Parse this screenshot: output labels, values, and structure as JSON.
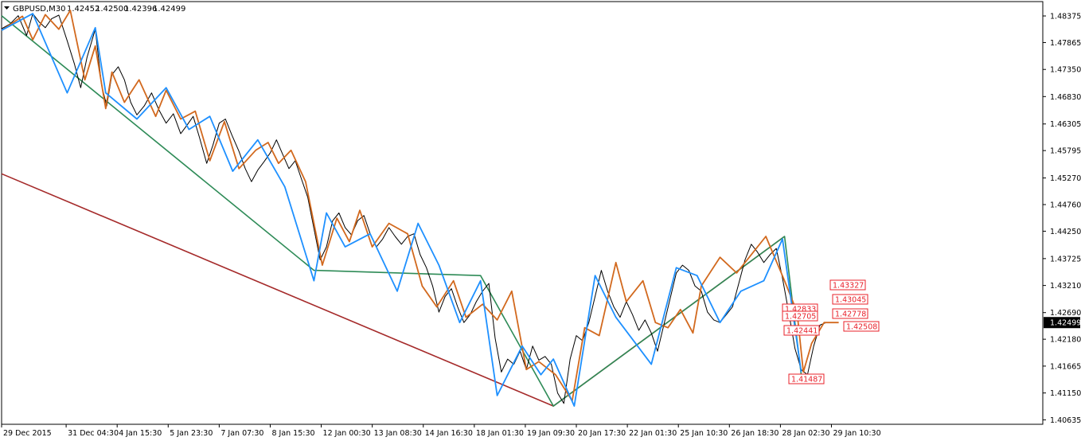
{
  "header": {
    "symbol": "GBPUSD,M30",
    "open": "1.42452",
    "high": "1.42500",
    "low": "1.42396",
    "close": "1.42499"
  },
  "colors": {
    "price": "#000000",
    "zigzag_fast": "#d2691e",
    "zigzag_mid": "#1e90ff",
    "zigzag_slow": "#2e8b57",
    "zigzag_major": "#a52a2a",
    "level_box": "#e8202a",
    "current_price_bg": "#000000",
    "axis": "#000000"
  },
  "chart_data": {
    "type": "line",
    "chart_subtype": "candlestick price chart with zigzag overlays",
    "ylim": [
      1.4055,
      1.4865
    ],
    "y_ticks": [
      "1.48375",
      "1.47865",
      "1.47350",
      "1.46830",
      "1.46305",
      "1.45795",
      "1.45270",
      "1.44760",
      "1.44250",
      "1.43725",
      "1.43210",
      "1.42690",
      "1.42180",
      "1.41665",
      "1.41150",
      "1.40635"
    ],
    "x_ticks": [
      "29 Dec 2015",
      "31 Dec 04:30",
      "4 Jan 15:30",
      "5 Jan 23:30",
      "7 Jan 07:30",
      "8 Jan 15:30",
      "12 Jan 00:30",
      "13 Jan 08:30",
      "14 Jan 16:30",
      "18 Jan 01:30",
      "19 Jan 09:30",
      "20 Jan 17:30",
      "22 Jan 01:30",
      "25 Jan 10:30",
      "26 Jan 18:30",
      "28 Jan 02:30",
      "29 Jan 10:30"
    ],
    "x_tick_positions": [
      0,
      0.062,
      0.111,
      0.16,
      0.209,
      0.258,
      0.307,
      0.356,
      0.405,
      0.454,
      0.503,
      0.552,
      0.601,
      0.65,
      0.699,
      0.748,
      0.797
    ],
    "price_series": {
      "name": "GBPUSD,M30",
      "x": [
        0.0,
        0.008,
        0.016,
        0.024,
        0.03,
        0.036,
        0.042,
        0.048,
        0.055,
        0.063,
        0.07,
        0.076,
        0.082,
        0.09,
        0.096,
        0.101,
        0.106,
        0.112,
        0.118,
        0.124,
        0.13,
        0.137,
        0.144,
        0.151,
        0.158,
        0.165,
        0.172,
        0.178,
        0.184,
        0.19,
        0.197,
        0.203,
        0.209,
        0.215,
        0.221,
        0.228,
        0.234,
        0.24,
        0.246,
        0.252,
        0.258,
        0.264,
        0.27,
        0.276,
        0.282,
        0.288,
        0.294,
        0.3,
        0.306,
        0.312,
        0.318,
        0.324,
        0.33,
        0.336,
        0.342,
        0.348,
        0.354,
        0.36,
        0.366,
        0.372,
        0.378,
        0.384,
        0.39,
        0.396,
        0.402,
        0.408,
        0.414,
        0.42,
        0.426,
        0.432,
        0.438,
        0.444,
        0.45,
        0.456,
        0.462,
        0.468,
        0.474,
        0.48,
        0.486,
        0.492,
        0.498,
        0.504,
        0.51,
        0.516,
        0.522,
        0.528,
        0.534,
        0.54,
        0.546,
        0.552,
        0.558,
        0.564,
        0.57,
        0.576,
        0.582,
        0.588,
        0.594,
        0.6,
        0.606,
        0.612,
        0.618,
        0.624,
        0.63,
        0.636,
        0.642,
        0.648,
        0.654,
        0.66,
        0.666,
        0.672,
        0.678,
        0.684,
        0.69,
        0.696,
        0.702,
        0.708,
        0.714,
        0.72,
        0.726,
        0.732,
        0.738,
        0.744,
        0.75,
        0.756,
        0.762,
        0.768,
        0.774,
        0.78,
        0.786,
        0.792,
        0.798,
        0.804
      ],
      "values": [
        1.4813,
        1.4822,
        1.4838,
        1.48,
        1.4842,
        1.4826,
        1.4815,
        1.4832,
        1.4839,
        1.479,
        1.4745,
        1.47,
        1.4758,
        1.4812,
        1.4705,
        1.4665,
        1.4725,
        1.474,
        1.4715,
        1.4672,
        1.4648,
        1.4665,
        1.469,
        1.4658,
        1.4632,
        1.465,
        1.4612,
        1.4628,
        1.4645,
        1.4605,
        1.4555,
        1.459,
        1.4632,
        1.464,
        1.461,
        1.4578,
        1.4545,
        1.452,
        1.4542,
        1.4558,
        1.4575,
        1.46,
        1.4572,
        1.4545,
        1.456,
        1.4525,
        1.449,
        1.443,
        1.437,
        1.4395,
        1.4445,
        1.446,
        1.4432,
        1.4418,
        1.4445,
        1.4455,
        1.442,
        1.4395,
        1.441,
        1.4432,
        1.4415,
        1.44,
        1.4415,
        1.442,
        1.438,
        1.4355,
        1.432,
        1.427,
        1.43,
        1.4315,
        1.428,
        1.425,
        1.4265,
        1.429,
        1.431,
        1.4325,
        1.422,
        1.4155,
        1.418,
        1.417,
        1.4195,
        1.416,
        1.4205,
        1.4178,
        1.4185,
        1.417,
        1.4115,
        1.4095,
        1.418,
        1.4225,
        1.4215,
        1.425,
        1.43,
        1.435,
        1.431,
        1.428,
        1.426,
        1.429,
        1.4265,
        1.4235,
        1.4255,
        1.423,
        1.4195,
        1.4245,
        1.4295,
        1.4345,
        1.436,
        1.435,
        1.432,
        1.431,
        1.427,
        1.4255,
        1.425,
        1.4265,
        1.428,
        1.4325,
        1.437,
        1.44,
        1.4385,
        1.4365,
        1.438,
        1.4392,
        1.4335,
        1.427,
        1.42,
        1.416,
        1.415,
        1.4205,
        1.4245,
        1.425
      ]
    },
    "zigzag_fast": {
      "x": [
        0.0,
        0.02,
        0.03,
        0.042,
        0.055,
        0.066,
        0.08,
        0.09,
        0.1,
        0.106,
        0.118,
        0.132,
        0.148,
        0.158,
        0.172,
        0.186,
        0.2,
        0.214,
        0.228,
        0.244,
        0.256,
        0.266,
        0.278,
        0.292,
        0.308,
        0.322,
        0.334,
        0.344,
        0.356,
        0.372,
        0.39,
        0.404,
        0.418,
        0.434,
        0.446,
        0.462,
        0.476,
        0.49,
        0.504,
        0.516,
        0.532,
        0.548,
        0.56,
        0.574,
        0.59,
        0.6,
        0.616,
        0.628,
        0.64,
        0.652,
        0.664,
        0.672,
        0.69,
        0.706,
        0.72,
        0.734,
        0.752,
        0.764,
        0.77,
        0.778,
        0.79,
        0.804
      ],
      "values": [
        1.481,
        1.4837,
        1.4792,
        1.484,
        1.4812,
        1.4848,
        1.4715,
        1.478,
        1.466,
        1.473,
        1.4672,
        1.4715,
        1.4645,
        1.4695,
        1.464,
        1.4655,
        1.456,
        1.4635,
        1.4545,
        1.458,
        1.4595,
        1.4555,
        1.458,
        1.452,
        1.436,
        1.445,
        1.4405,
        1.4465,
        1.4395,
        1.444,
        1.442,
        1.432,
        1.428,
        1.433,
        1.426,
        1.4285,
        1.4255,
        1.431,
        1.416,
        1.4175,
        1.415,
        1.41,
        1.424,
        1.4225,
        1.4365,
        1.429,
        1.433,
        1.425,
        1.424,
        1.4275,
        1.423,
        1.432,
        1.4375,
        1.4345,
        1.438,
        1.4415,
        1.433,
        1.427,
        1.4155,
        1.421,
        1.425,
        1.425
      ]
    },
    "zigzag_mid": {
      "x": [
        0.0,
        0.03,
        0.063,
        0.09,
        0.1,
        0.13,
        0.158,
        0.18,
        0.2,
        0.222,
        0.246,
        0.272,
        0.3,
        0.312,
        0.33,
        0.354,
        0.38,
        0.4,
        0.42,
        0.44,
        0.46,
        0.476,
        0.5,
        0.518,
        0.53,
        0.55,
        0.57,
        0.59,
        0.624,
        0.648,
        0.668,
        0.69,
        0.71,
        0.732,
        0.75,
        0.768
      ],
      "values": [
        1.481,
        1.4842,
        1.469,
        1.4815,
        1.469,
        1.464,
        1.47,
        1.462,
        1.4645,
        1.454,
        1.46,
        1.451,
        1.433,
        1.446,
        1.4395,
        1.442,
        1.431,
        1.444,
        1.436,
        1.425,
        1.433,
        1.411,
        1.4205,
        1.415,
        1.418,
        1.409,
        1.434,
        1.426,
        1.417,
        1.4355,
        1.434,
        1.425,
        1.431,
        1.433,
        1.441,
        1.4155
      ]
    },
    "zigzag_slow": {
      "x": [
        0.0,
        0.3,
        0.46,
        0.53,
        0.752,
        0.768
      ],
      "values": [
        1.4838,
        1.435,
        1.434,
        1.409,
        1.4415,
        1.415
      ]
    },
    "zigzag_major": {
      "x": [
        0.0,
        0.53,
        0.752
      ],
      "values": [
        1.4535,
        1.409,
        1.4415
      ]
    },
    "levels": [
      "1.43327",
      "1.43045",
      "1.42833",
      "1.42705",
      "1.42778",
      "1.42441",
      "1.42508",
      "1.41487"
    ],
    "current_price": "1.42499",
    "grid": false,
    "title": "",
    "xlabel": "",
    "ylabel": ""
  }
}
